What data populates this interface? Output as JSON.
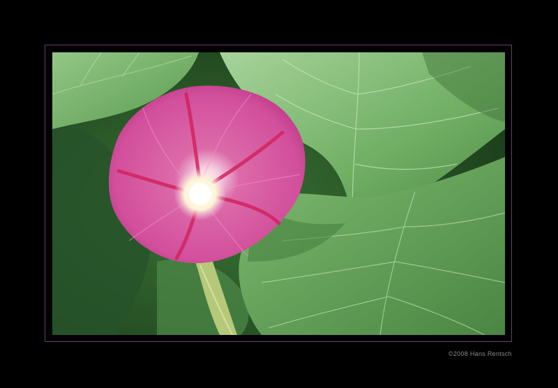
{
  "photo": {
    "subject": "pink morning glory flower among green leaves",
    "colors": {
      "background": "#000000",
      "frame": "#6a3f6e",
      "leaf_light": "#8cc27d",
      "leaf_mid": "#5f9e55",
      "leaf_dark": "#2f5f2c",
      "petal": "#d14a9a",
      "petal_light": "#e07bb8",
      "petal_stripe": "#d1245e",
      "throat": "#fff8e6"
    }
  },
  "credit": {
    "text": "©2008 Hans Rentsch"
  }
}
